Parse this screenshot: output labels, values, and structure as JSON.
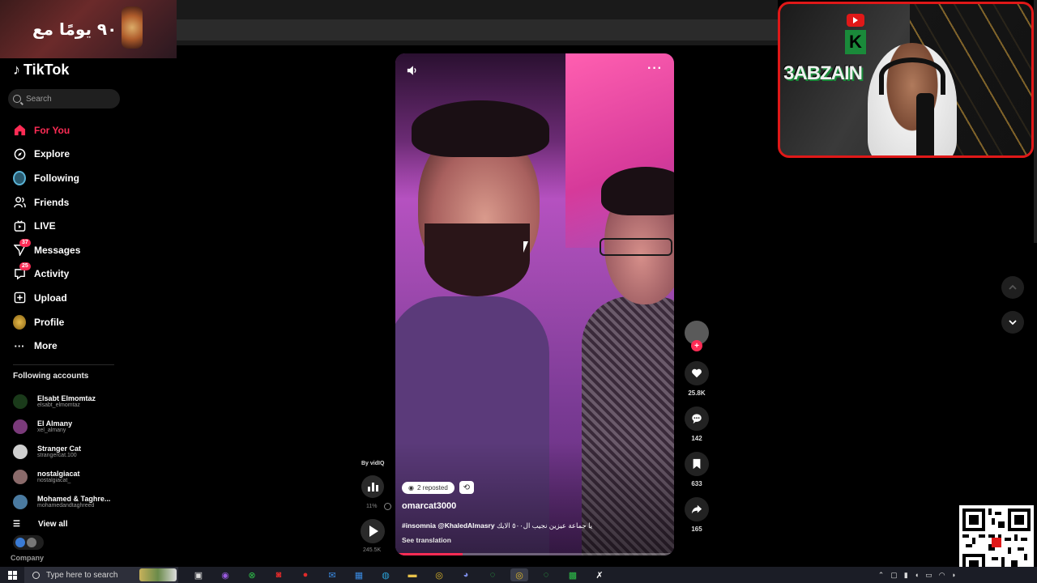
{
  "banner": {
    "text": "٩٠ يومًا مع"
  },
  "app": {
    "name": "TikTok"
  },
  "search": {
    "placeholder": "Search"
  },
  "nav": [
    {
      "label": "For You",
      "icon": "home-icon",
      "active": true
    },
    {
      "label": "Explore",
      "icon": "compass-icon"
    },
    {
      "label": "Following",
      "icon": "following-avatar-icon"
    },
    {
      "label": "Friends",
      "icon": "friends-icon"
    },
    {
      "label": "LIVE",
      "icon": "live-icon"
    },
    {
      "label": "Messages",
      "icon": "messages-icon",
      "badge": "37"
    },
    {
      "label": "Activity",
      "icon": "activity-icon",
      "badge": "25"
    },
    {
      "label": "Upload",
      "icon": "upload-icon"
    },
    {
      "label": "Profile",
      "icon": "profile-icon"
    },
    {
      "label": "More",
      "icon": "more-icon"
    }
  ],
  "following_accounts": {
    "title": "Following accounts",
    "accounts": [
      {
        "name": "Elsabt Elmomtaz",
        "handle": "elsabt_elmomtaz",
        "color": "#1a3a1a"
      },
      {
        "name": "El Almany",
        "handle": "xel_almany",
        "color": "#7a3a7a"
      },
      {
        "name": "Stranger Cat",
        "handle": "strangercat.100",
        "color": "#cfcfcf"
      },
      {
        "name": "nostalgiacat",
        "handle": "nostalgiacat_",
        "color": "#8a6a6a"
      },
      {
        "name": "Mohamed & Taghre...",
        "handle": "mohamedandtaghreed",
        "color": "#4a7aa0"
      }
    ],
    "view_all": "View all"
  },
  "footer": {
    "company": "Company"
  },
  "video": {
    "repost_text": "2 reposted",
    "author": "omarcat3000",
    "caption_tags": "#insomnia @KhaledAlmasry",
    "caption_text": "يا جماعة عيزين نجيب ال٥٠٠ الايك",
    "see_translation": "See translation",
    "progress": 0.24
  },
  "vidiq": {
    "by": "By vidIQ",
    "percent": "11%",
    "views": "245.5K"
  },
  "actions": {
    "likes": "25.8K",
    "comments": "142",
    "saves": "633",
    "shares": "165"
  },
  "webcam": {
    "brand": "3ABZAIN"
  },
  "taskbar": {
    "search_placeholder": "Type here to search"
  },
  "colors": {
    "accent": "#fe2c55",
    "webcam_border": "#e01818"
  }
}
